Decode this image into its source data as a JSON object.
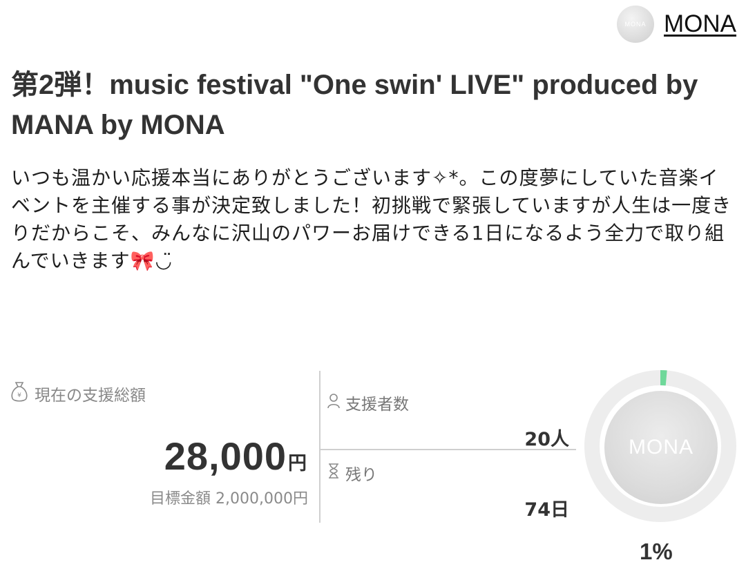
{
  "owner": {
    "avatar_text": "MONA",
    "name": "MONA"
  },
  "project": {
    "title": "第2弾！music festival \"One swin' LIVE\" produced by MANA by MONA",
    "description": "いつも温かい応援本当にありがとうございます✧*。この度夢にしていた音楽イベントを主催する事が決定致しました！初挑戦で緊張していますが人生は一度きりだからこそ、みんなに沢山のパワーお届けできる1日になるよう全力で取り組んでいきます🎀◡̈"
  },
  "stats": {
    "total_label": "現在の支援総額",
    "total_amount": "28,000",
    "total_unit": "円",
    "goal_text": "目標金額 2,000,000円",
    "supporters_label": "支援者数",
    "supporters_value": "20人",
    "remaining_label": "残り",
    "remaining_value": "74日",
    "ring_center_text": "MONA",
    "percent_text": "1%",
    "progress_fraction": 0.014
  },
  "colors": {
    "accent_green": "#6fd89a",
    "ring_track": "#ededed",
    "text_main": "#333333",
    "text_muted": "#888888"
  },
  "icons": {
    "money_bag": "money-bag-icon",
    "person": "person-icon",
    "hourglass": "hourglass-icon"
  }
}
